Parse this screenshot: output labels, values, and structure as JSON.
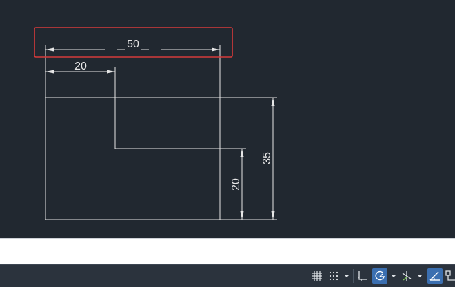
{
  "drawing": {
    "dim_top": "50",
    "dim_left": "20",
    "dim_right_outer": "35",
    "dim_right_inner": "20"
  },
  "highlight_color": "#d63a3a",
  "line_color": "#e6e6e6",
  "command_line": {
    "value": "",
    "placeholder": ""
  },
  "status_bar": {
    "icons": [
      "grid-icon",
      "snap-icon",
      "dropdown-icon",
      "ortho-icon",
      "polar-icon",
      "dropdown-icon",
      "isodraft-icon",
      "dropdown-icon",
      "object-snap-tracking-icon",
      "object-snap-icon"
    ]
  }
}
